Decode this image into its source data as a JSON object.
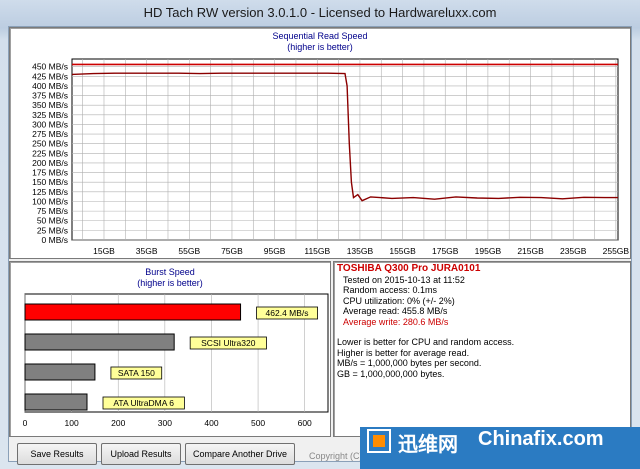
{
  "window": {
    "title": "HD Tach RW version 3.0.1.0 - Licensed to Hardwareluxx.com"
  },
  "seq_chart_title": [
    "Sequential Read Speed",
    "(higher is better)"
  ],
  "burst_chart_title": [
    "Burst Speed",
    "(higher is better)"
  ],
  "info": {
    "drive_name": "TOSHIBA Q300 Pro JURA0101",
    "tested_on": "Tested on 2015-10-13 at 11:52",
    "random_access": "Random access: 0.1ms",
    "cpu": "CPU utilization: 0% (+/- 2%)",
    "avg_read": "Average read: 455.8 MB/s",
    "avg_write": "Average write: 280.6 MB/s",
    "note1": "Lower is better for CPU and random access.",
    "note2": "Higher is better for average read.",
    "note3": "MB/s = 1,000,000 bytes per second.",
    "note4": "GB = 1,000,000,000 bytes."
  },
  "buttons": {
    "save": "Save Results",
    "upload": "Upload Results",
    "compare": "Compare Another Drive"
  },
  "copyright": "Copyright (C) 2004",
  "watermark": {
    "cn": "迅维网",
    "en": "Chinafix.com"
  },
  "colors": {
    "read": "#8b0000",
    "write": "#cc0000",
    "burst": "#ff0000",
    "ref": "#808080"
  },
  "chart_data": [
    {
      "type": "line",
      "title": "Sequential Read Speed (higher is better)",
      "ylim": [
        0,
        470
      ],
      "yticks": [
        "0 MB/s",
        "25 MB/s",
        "50 MB/s",
        "75 MB/s",
        "100 MB/s",
        "125 MB/s",
        "150 MB/s",
        "175 MB/s",
        "200 MB/s",
        "225 MB/s",
        "250 MB/s",
        "275 MB/s",
        "300 MB/s",
        "325 MB/s",
        "350 MB/s",
        "375 MB/s",
        "400 MB/s",
        "425 MB/s",
        "450 MB/s"
      ],
      "xticks": [
        "15GB",
        "35GB",
        "55GB",
        "75GB",
        "95GB",
        "115GB",
        "135GB",
        "155GB",
        "175GB",
        "195GB",
        "215GB",
        "235GB",
        "255GB"
      ],
      "xlim": [
        0,
        256
      ],
      "series": [
        {
          "name": "Average read",
          "value": 455.8
        },
        {
          "name": "Write",
          "x": [
            0,
            10,
            20,
            30,
            40,
            50,
            60,
            70,
            80,
            90,
            100,
            110,
            120,
            128,
            129,
            130,
            131,
            132,
            134,
            136,
            140,
            150,
            160,
            170,
            180,
            190,
            200,
            210,
            220,
            230,
            240,
            250,
            256
          ],
          "y": [
            430,
            432,
            433,
            433,
            433,
            433,
            432,
            433,
            433,
            433,
            433,
            433,
            433,
            432,
            400,
            250,
            150,
            110,
            118,
            102,
            112,
            108,
            110,
            106,
            112,
            109,
            108,
            111,
            110,
            107,
            111,
            110,
            110
          ]
        }
      ]
    },
    {
      "type": "bar",
      "title": "Burst Speed (higher is better)",
      "xlim": [
        0,
        650
      ],
      "xticks": [
        0,
        100,
        200,
        300,
        400,
        500,
        600
      ],
      "categories": [
        "462.4 MB/s",
        "SCSI Ultra320",
        "SATA 150",
        "ATA UltraDMA 6"
      ],
      "values": [
        462.4,
        320,
        150,
        133
      ]
    }
  ]
}
